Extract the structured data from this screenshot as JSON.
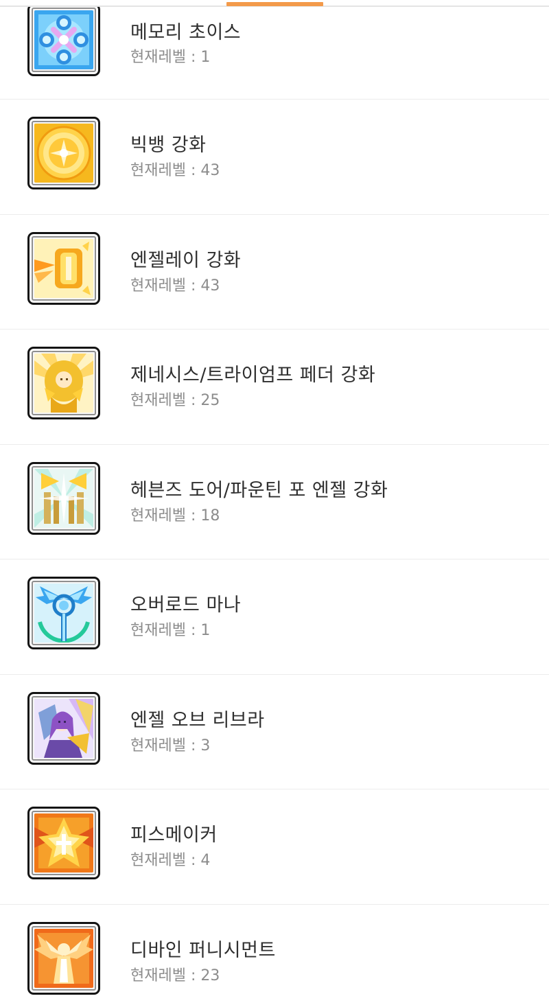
{
  "tab_indicator_color": "#f39a4a",
  "level_prefix": "현재레벨 : ",
  "skills": [
    {
      "name": "메모리 초이스",
      "level": "1",
      "icon": "memory-choice-icon"
    },
    {
      "name": "빅뱅 강화",
      "level": "43",
      "icon": "big-bang-icon"
    },
    {
      "name": "엔젤레이 강화",
      "level": "43",
      "icon": "angel-ray-icon"
    },
    {
      "name": "제네시스/트라이엄프 페더 강화",
      "level": "25",
      "icon": "genesis-icon"
    },
    {
      "name": "헤븐즈 도어/파운틴 포 엔젤 강화",
      "level": "18",
      "icon": "heavens-door-icon"
    },
    {
      "name": "오버로드 마나",
      "level": "1",
      "icon": "overload-mana-icon"
    },
    {
      "name": "엔젤 오브 리브라",
      "level": "3",
      "icon": "angel-of-libra-icon"
    },
    {
      "name": "피스메이커",
      "level": "4",
      "icon": "peacemaker-icon"
    },
    {
      "name": "디바인 퍼니시먼트",
      "level": "23",
      "icon": "divine-punishment-icon"
    }
  ]
}
